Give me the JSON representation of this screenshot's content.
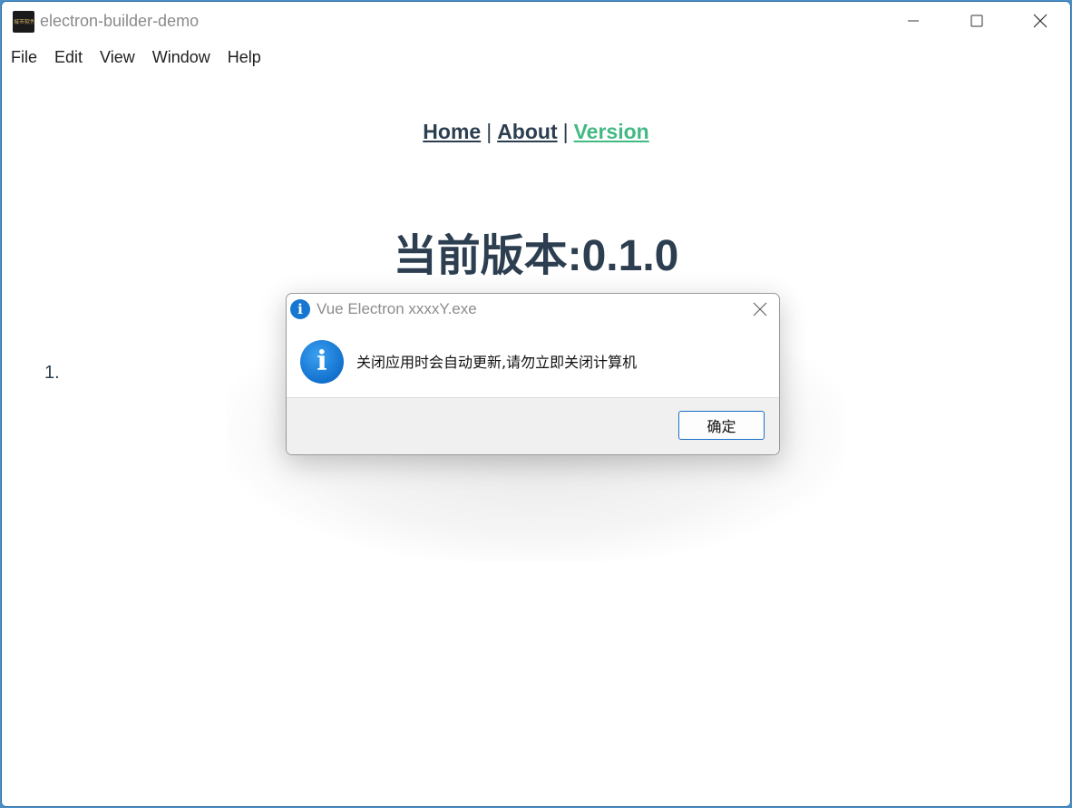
{
  "window": {
    "title": "electron-builder-demo",
    "icon_text": "城市软件"
  },
  "menu": {
    "items": [
      "File",
      "Edit",
      "View",
      "Window",
      "Help"
    ]
  },
  "nav": {
    "home": "Home",
    "separator1": "|",
    "about": "About",
    "separator2": "|",
    "version": "Version",
    "active": "Version"
  },
  "page": {
    "heading": "当前版本:0.1.0",
    "list_marker": "1."
  },
  "dialog": {
    "title": "Vue Electron xxxxY.exe",
    "message": "关闭应用时会自动更新,请勿立即关闭计算机",
    "ok_label": "确定",
    "icon": "info-icon"
  },
  "colors": {
    "accent_link": "#42b983",
    "text_dark": "#2c3e50",
    "dialog_button_border": "#1b6fc9",
    "info_blue": "#1574d0"
  }
}
